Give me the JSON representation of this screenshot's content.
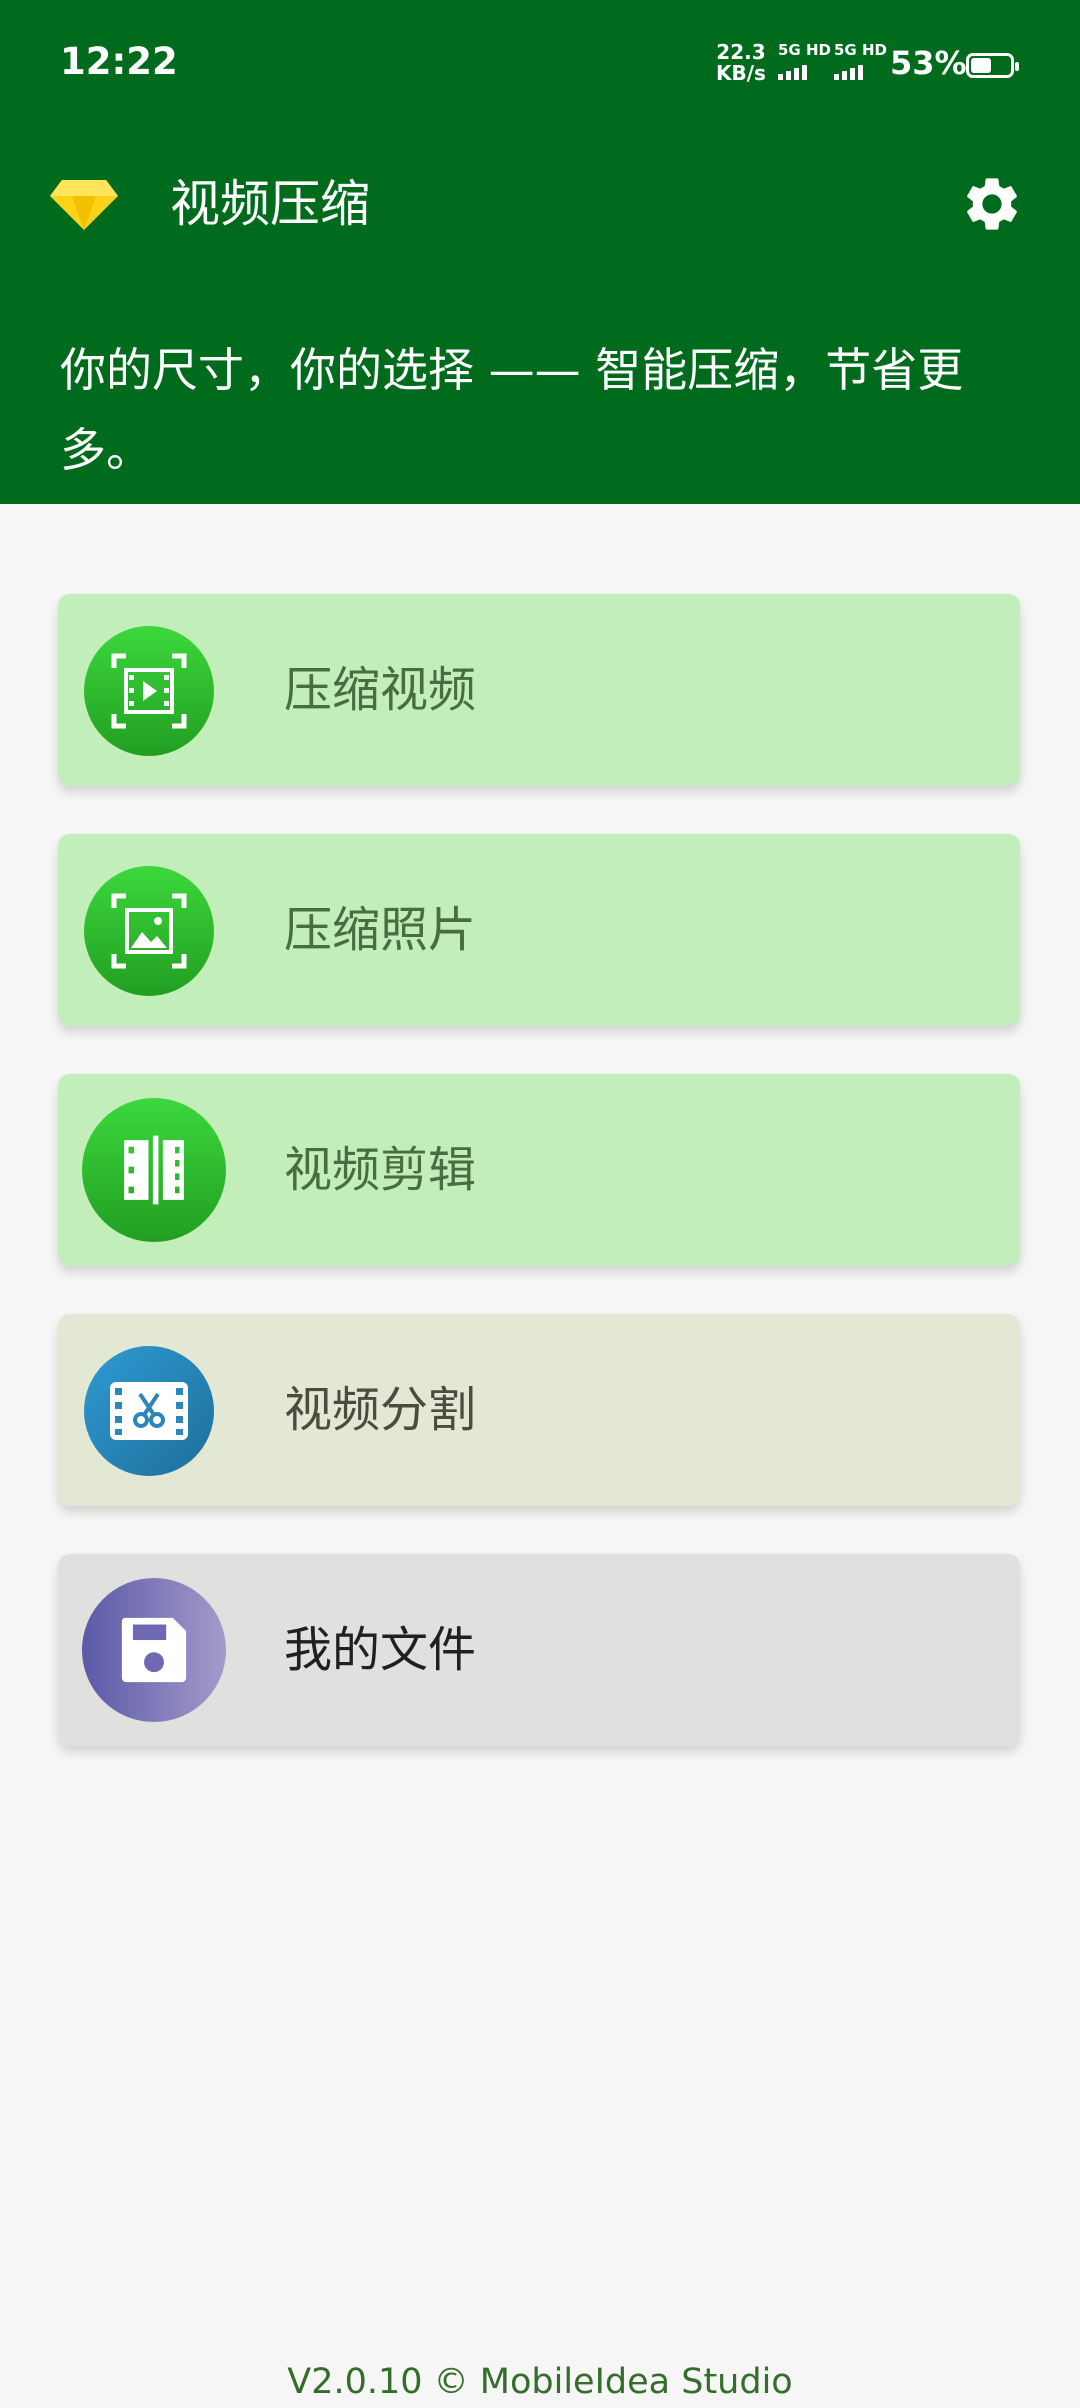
{
  "status_bar": {
    "time": "12:22",
    "net_speed_value": "22.3",
    "net_speed_unit": "KB/s",
    "sim1_label": "5G HD",
    "sim2_label": "5G HD",
    "battery_percent": "53%",
    "battery_level": 0.53
  },
  "app_bar": {
    "title": "视频压缩",
    "premium_icon": "diamond-icon",
    "settings_icon": "gear-icon"
  },
  "tagline": {
    "line1": "你的尺寸，你的选择 —— 智能压缩，节省更",
    "line2": "多。"
  },
  "menu": [
    {
      "label": "压缩视频",
      "icon": "compress-video-icon"
    },
    {
      "label": "压缩照片",
      "icon": "compress-photo-icon"
    },
    {
      "label": "视频剪辑",
      "icon": "video-trim-icon"
    },
    {
      "label": "视频分割",
      "icon": "video-split-icon"
    },
    {
      "label": "我的文件",
      "icon": "save-file-icon"
    }
  ],
  "footer": {
    "text": "V2.0.10 © MobileIdea Studio"
  },
  "colors": {
    "header_bg": "#006b1c",
    "page_bg": "#f5f6f5",
    "green_card_bg": "#c1eeb9",
    "olive_card_bg": "#e2e8d3",
    "grey_card_bg": "#e0e1df",
    "footer_text": "#356d2a"
  }
}
